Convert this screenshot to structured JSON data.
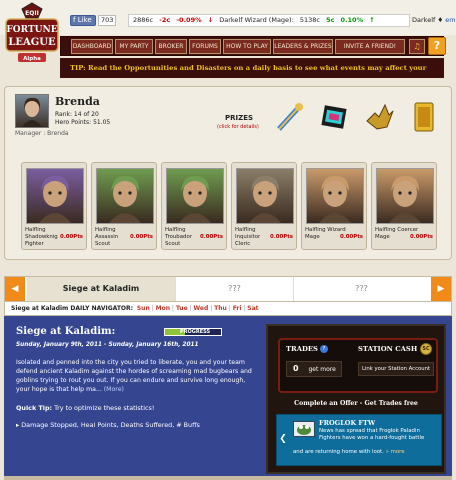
{
  "header": {
    "logo": {
      "top": "EQII",
      "main1": "FORTUNE",
      "main2": "LEAGUE",
      "sub": "Alpha"
    },
    "facebook": {
      "label": "Like",
      "count": "703"
    },
    "ticker": {
      "currency": "2886c",
      "change": "-2c",
      "change_pct": "-0.09%",
      "item": "Darkelf Wizard (Mage):",
      "currency2": "5138c",
      "change2": "5c",
      "change2_pct": "0.10%",
      "item2": "Darkelf"
    },
    "embed_label": "embed"
  },
  "nav": {
    "items": [
      "DASHBOARD",
      "MY PARTY",
      "BROKER",
      "FORUMS",
      "HOW TO PLAY",
      "LEADERS & PRIZES",
      "INVITE A FRIEND!"
    ],
    "sound_icon": "speaker-icon",
    "help_label": "?"
  },
  "tip": "TIP: Read the Opportunities and Disasters on a daily basis to see what events may affect your",
  "profile": {
    "name": "Brenda",
    "rank": "Rank: 14 of 20",
    "hero_points": "Hero Points: 51.05",
    "manager": "Manager : Brenda",
    "prizes_label": "PRIZES",
    "prizes_sub": "(click for details)"
  },
  "heroes": [
    {
      "name": "Halfling Shadowknight",
      "line1": "Halfling Shadowknig",
      "line2": "Fighter",
      "points": "0.00Pts",
      "bg": "#7a5ea0"
    },
    {
      "name": "Halfling Assassin",
      "line1": "Halfling Assassin",
      "line2": "Scout",
      "points": "0.00Pts",
      "bg": "#6f9c50"
    },
    {
      "name": "Halfling Troubador",
      "line1": "Halfling Troubador",
      "line2": "Scout",
      "points": "0.00Pts",
      "bg": "#6f9c50"
    },
    {
      "name": "Halfling Inquisitor",
      "line1": "Halfling Inquisitor",
      "line2": "Cleric",
      "points": "0.00Pts",
      "bg": "#8a7e68"
    },
    {
      "name": "Halfling Wizard",
      "line1": "Halfling Wizard",
      "line2": "Mage",
      "points": "0.00Pts",
      "bg": "#c99a6a"
    },
    {
      "name": "Halfling Coercer",
      "line1": "Halfling Coercer",
      "line2": "Mage",
      "points": "0.00Pts",
      "bg": "#c99a6a"
    }
  ],
  "tabs": {
    "active": "Siege at Kaladim",
    "others": [
      "???",
      "???"
    ],
    "prev_icon": "arrow-left-icon",
    "next_icon": "arrow-right-icon"
  },
  "daily": {
    "label": "Siege at Kaladim DAILY NAVIGATOR:",
    "days": [
      "Sun",
      "Mon",
      "Tue",
      "Wed",
      "Thu",
      "Fri",
      "Sat"
    ]
  },
  "event": {
    "title": "Siege at Kaladim:",
    "dates": "Sunday, January 9th, 2011 - Sunday, January 16th, 2011",
    "progress_label": "PROGRESS",
    "progress": 0.35,
    "description": "Isolated and penned into the city you tried to liberate, you and your team defend ancient Kaladim against the hordes of screaming mad bugbears and goblins trying to rout you out. If you can endure and survive long enough, your hope is that help ma...",
    "more": "(More)",
    "quick_tip_label": "Quick Tip:",
    "quick_tip": "Try to optimize these statistics!",
    "bullet": "▸ Damage Stopped, Heal Points, Deaths Suffered, # Buffs"
  },
  "trades": {
    "label": "TRADES",
    "count": "0",
    "get_more": "get more",
    "station_cash_label": "STATION CASH",
    "link_label": "Link your Station Account",
    "offer": "Complete an Offer - Get Trades free"
  },
  "promo": {
    "title": "FROGLOK FTW",
    "text": "News has spread that Froglok Paladin Fighters have won a hard-fought battle",
    "text2": "and are returning home with loot.",
    "more": "» more"
  }
}
